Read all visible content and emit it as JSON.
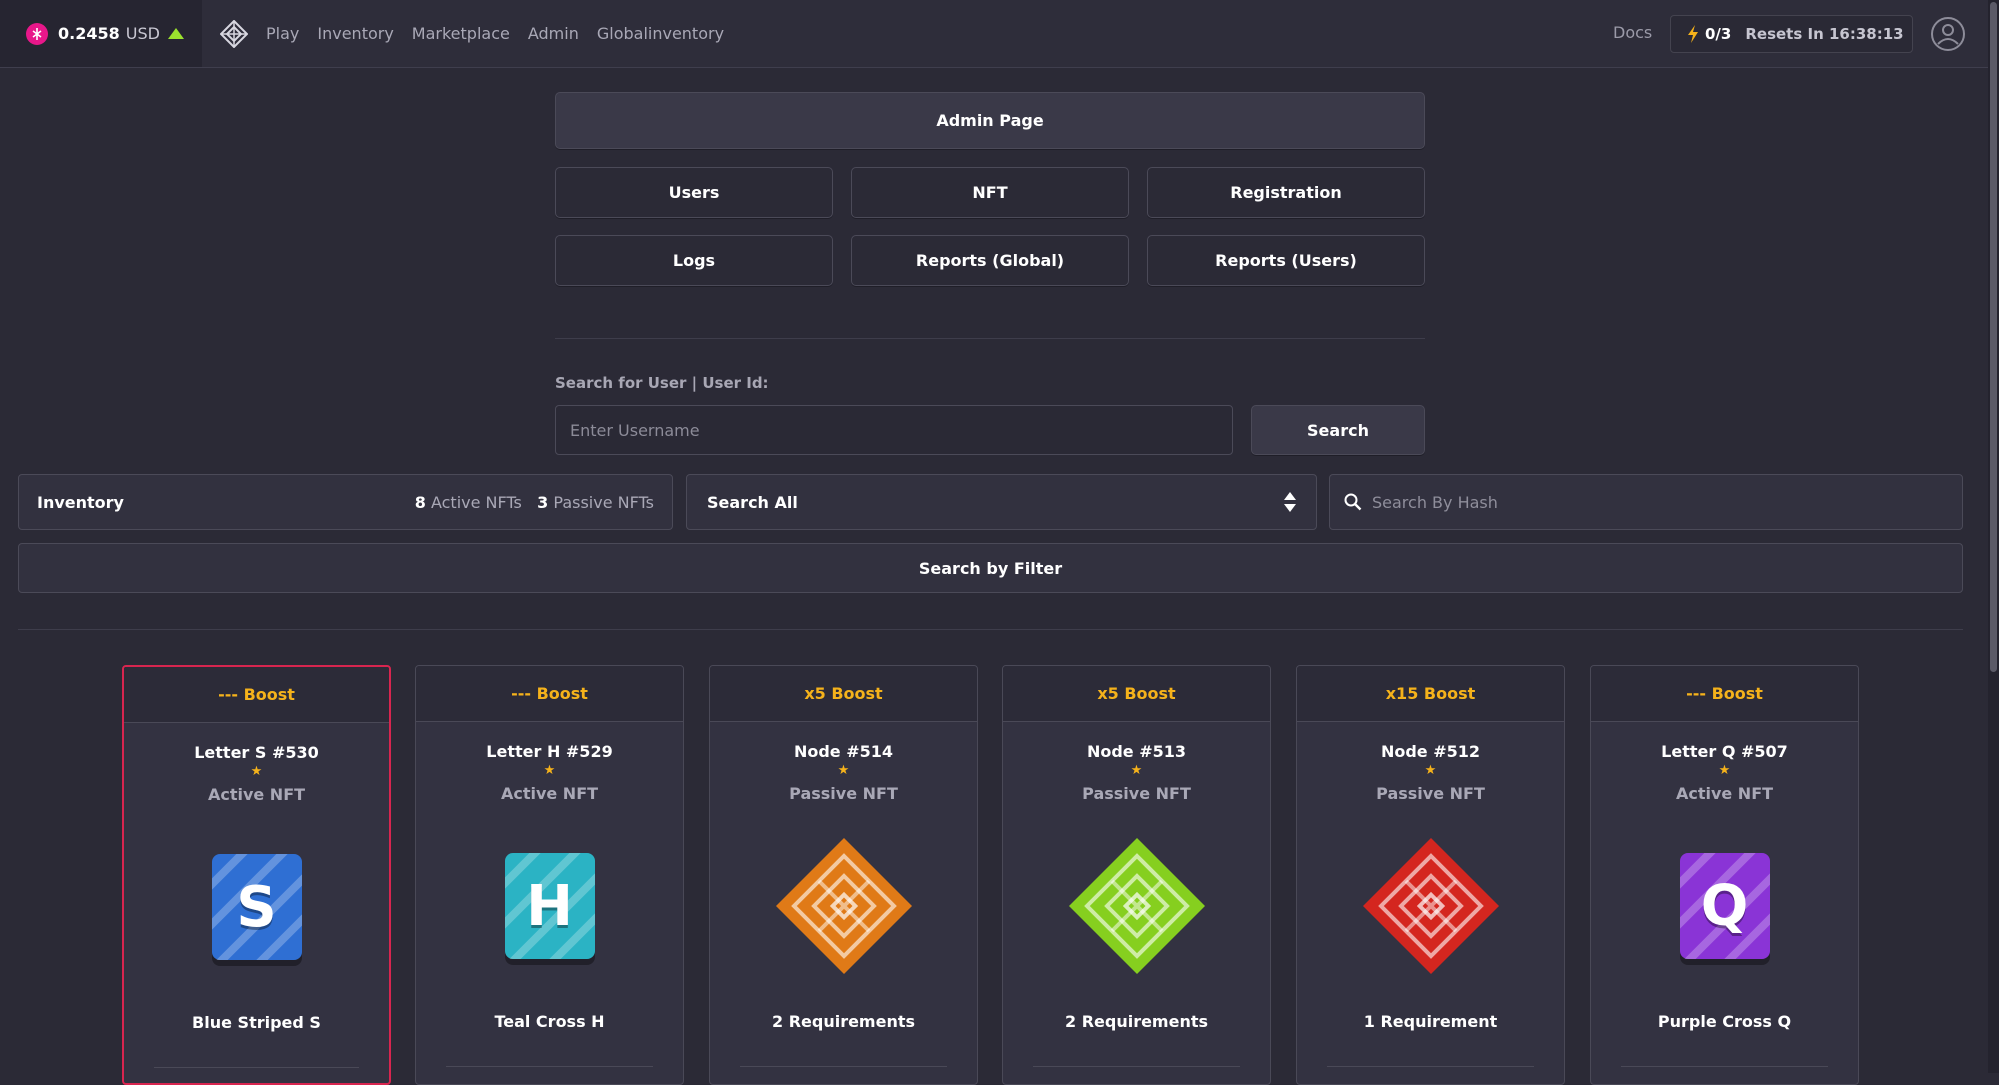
{
  "topbar": {
    "price": "0.2458",
    "currency": "USD",
    "nav": [
      "Play",
      "Inventory",
      "Marketplace",
      "Admin",
      "Globalinventory"
    ],
    "docs": "Docs",
    "energy_count": "0/3",
    "reset_text": "Resets In 16:38:13"
  },
  "admin": {
    "title": "Admin Page",
    "buttons_row1": [
      "Users",
      "NFT",
      "Registration"
    ],
    "buttons_row2": [
      "Logs",
      "Reports (Global)",
      "Reports (Users)"
    ],
    "search_label": "Search for User | User Id:",
    "search_placeholder": "Enter Username",
    "search_button": "Search"
  },
  "inventory": {
    "title": "Inventory",
    "active_count": "8",
    "active_label": "Active NFTs",
    "passive_count": "3",
    "passive_label": "Passive NFTs",
    "select_value": "Search All",
    "hash_placeholder": "Search By Hash",
    "filter_button": "Search by Filter"
  },
  "cards": [
    {
      "boost": "--- Boost",
      "name": "Letter S #530",
      "star": "★",
      "type": "Active NFT",
      "desc": "Blue Striped S",
      "art": "S",
      "color": "#2f6fd3"
    },
    {
      "boost": "--- Boost",
      "name": "Letter H #529",
      "star": "★",
      "type": "Active NFT",
      "desc": "Teal Cross H",
      "art": "H",
      "color": "#2bb3c4"
    },
    {
      "boost": "x5 Boost",
      "name": "Node #514",
      "star": "★",
      "type": "Passive NFT",
      "desc": "2 Requirements",
      "art": "node",
      "color": "#e07a17"
    },
    {
      "boost": "x5 Boost",
      "name": "Node #513",
      "star": "★",
      "type": "Passive NFT",
      "desc": "2 Requirements",
      "art": "node",
      "color": "#86cf1f"
    },
    {
      "boost": "x15 Boost",
      "name": "Node #512",
      "star": "★",
      "type": "Passive NFT",
      "desc": "1 Requirement",
      "art": "node",
      "color": "#d4261f"
    },
    {
      "boost": "--- Boost",
      "name": "Letter Q #507",
      "star": "★",
      "type": "Active NFT",
      "desc": "Purple Cross Q",
      "art": "Q",
      "color": "#8a34d6"
    }
  ]
}
